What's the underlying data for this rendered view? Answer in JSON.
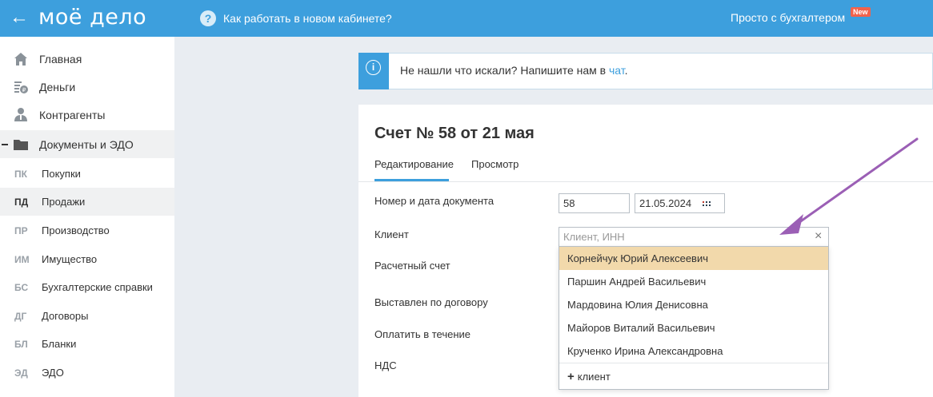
{
  "header": {
    "back_glyph": "←",
    "logo": "моё дело",
    "help_icon": "?",
    "help_link": "Как работать в новом кабинете?",
    "simple_link": "Просто с бухгалтером",
    "new_badge": "New"
  },
  "sidebar": {
    "items": [
      {
        "label": "Главная",
        "icon": "home-icon"
      },
      {
        "label": "Деньги",
        "icon": "money-icon"
      },
      {
        "label": "Контрагенты",
        "icon": "contractors-icon"
      },
      {
        "label": "Документы и ЭДО",
        "icon": "folder-icon"
      }
    ],
    "subitems": [
      {
        "abbr": "ПК",
        "label": "Покупки"
      },
      {
        "abbr": "ПД",
        "label": "Продажи"
      },
      {
        "abbr": "ПР",
        "label": "Производство"
      },
      {
        "abbr": "ИМ",
        "label": "Имущество"
      },
      {
        "abbr": "БС",
        "label": "Бухгалтерские справки"
      },
      {
        "abbr": "ДГ",
        "label": "Договоры"
      },
      {
        "abbr": "БЛ",
        "label": "Бланки"
      },
      {
        "abbr": "ЭД",
        "label": "ЭДО"
      }
    ]
  },
  "banner": {
    "icon": "i",
    "text": "Не нашли что искали? Напишите нам в ",
    "link": "чат",
    "suffix": "."
  },
  "document": {
    "title": "Счет № 58 от 21 мая",
    "tabs": [
      {
        "label": "Редактирование",
        "active": true
      },
      {
        "label": "Просмотр",
        "active": false
      }
    ]
  },
  "form": {
    "number_date_label": "Номер и дата документа",
    "number_value": "58",
    "date_value": "21.05.2024",
    "client_label": "Клиент",
    "client_placeholder": "Клиент, ИНН",
    "clear_glyph": "×",
    "account_label": "Расчетный счет",
    "contract_label": "Выставлен по договору",
    "payment_label": "Оплатить в течение",
    "vat_label": "НДС"
  },
  "dropdown": {
    "options": [
      "Корнейчук Юрий Алексеевич",
      "Паршин Андрей Васильевич",
      "Мардовина Юлия Денисовна",
      "Майоров Виталий Васильевич",
      "Крученко Ирина Александровна"
    ],
    "add_glyph": "+",
    "add_label": "клиент"
  },
  "colors": {
    "accent": "#3d9fdd",
    "highlight": "#f2d9ab",
    "badge": "#f2624b",
    "arrow": "#9b5fb5"
  }
}
